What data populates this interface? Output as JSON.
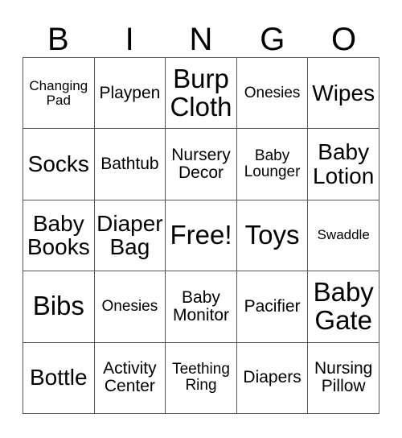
{
  "card": {
    "title_letters": [
      "B",
      "I",
      "N",
      "G",
      "O"
    ],
    "free_space_label": "Free!",
    "grid_size": "5x5",
    "colors": {
      "background": "#ffffff",
      "text": "#000000",
      "border": "#555555"
    },
    "rows": [
      [
        {
          "label": "Changing\nPad",
          "size": "sz-s"
        },
        {
          "label": "Playpen",
          "size": "sz-ml"
        },
        {
          "label": "Burp\nCloth",
          "size": "sz-xxl"
        },
        {
          "label": "Onesies",
          "size": "sz-m"
        },
        {
          "label": "Wipes",
          "size": "sz-xl"
        }
      ],
      [
        {
          "label": "Socks",
          "size": "sz-xl"
        },
        {
          "label": "Bathtub",
          "size": "sz-ml"
        },
        {
          "label": "Nursery\nDecor",
          "size": "sz-ml"
        },
        {
          "label": "Baby\nLounger",
          "size": "sz-m"
        },
        {
          "label": "Baby\nLotion",
          "size": "sz-xl"
        }
      ],
      [
        {
          "label": "Baby\nBooks",
          "size": "sz-xl"
        },
        {
          "label": "Diaper\nBag",
          "size": "sz-xl"
        },
        {
          "label": "Free!",
          "size": "sz-xxl"
        },
        {
          "label": "Toys",
          "size": "sz-xxl"
        },
        {
          "label": "Swaddle",
          "size": "sz-s"
        }
      ],
      [
        {
          "label": "Bibs",
          "size": "sz-xxl"
        },
        {
          "label": "Onesies",
          "size": "sz-m"
        },
        {
          "label": "Baby\nMonitor",
          "size": "sz-ml"
        },
        {
          "label": "Pacifier",
          "size": "sz-ml"
        },
        {
          "label": "Baby\nGate",
          "size": "sz-xxl"
        }
      ],
      [
        {
          "label": "Bottle",
          "size": "sz-xl"
        },
        {
          "label": "Activity\nCenter",
          "size": "sz-ml"
        },
        {
          "label": "Teething\nRing",
          "size": "sz-m"
        },
        {
          "label": "Diapers",
          "size": "sz-ml"
        },
        {
          "label": "Nursing\nPillow",
          "size": "sz-ml"
        }
      ]
    ]
  }
}
